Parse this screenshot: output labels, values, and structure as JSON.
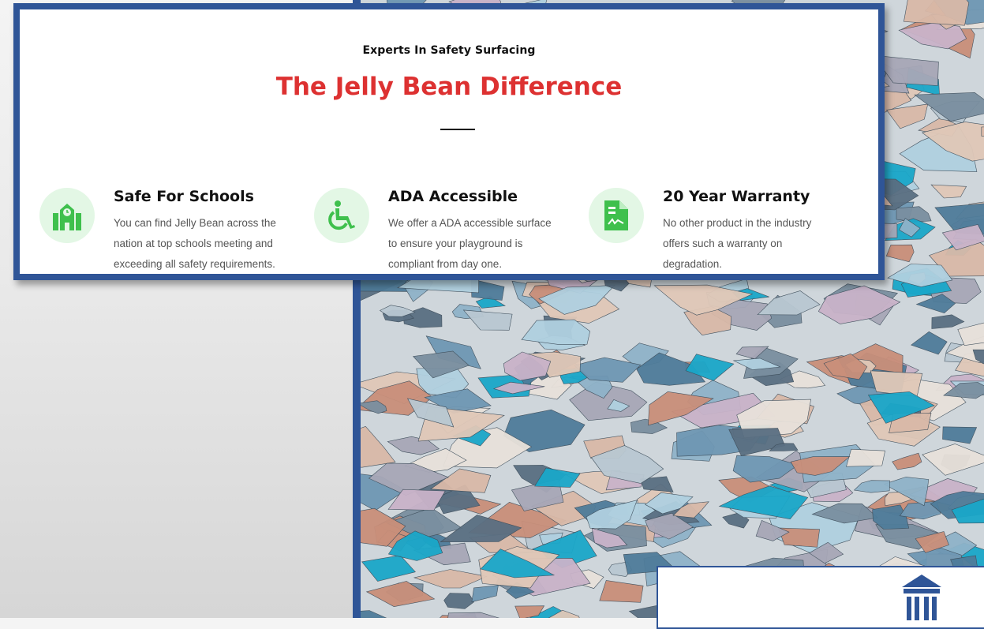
{
  "section": {
    "eyebrow": "Experts In Safety Surfacing",
    "headline": "The Jelly Bean Difference"
  },
  "features": [
    {
      "title": "Safe For Schools",
      "icon": "school-icon",
      "lines": [
        "You can find Jelly Bean across the",
        "nation at top schools meeting and",
        "exceeding all safety requirements."
      ]
    },
    {
      "title": "ADA Accessible",
      "icon": "wheelchair-icon",
      "lines": [
        "We offer a ADA accessible surface",
        "to ensure your playground is",
        "compliant from day one."
      ]
    },
    {
      "title": "20 Year Warranty",
      "icon": "certificate-document-icon",
      "lines": [
        "No other product in the industry",
        "offers such a warranty on",
        "degradation."
      ]
    }
  ],
  "colors": {
    "accent_red": "#dd3131",
    "border_blue": "#2f5597",
    "icon_green": "#3fc04d",
    "icon_bg": "#e3f7e5"
  }
}
